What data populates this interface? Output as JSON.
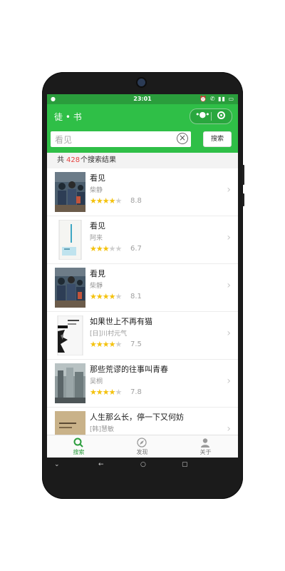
{
  "status_bar": {
    "time": "23:01",
    "left_icon": "notification-dot-icon",
    "right_icons": "⏰ ✆ ▮▮ ▭"
  },
  "nav": {
    "title": "徒 • 书",
    "more_icon": "more-dots-icon",
    "close_icon": "target-icon"
  },
  "search": {
    "value": "看见",
    "button_label": "搜索"
  },
  "results": {
    "prefix": "共",
    "count": "428",
    "suffix": "个搜索结果"
  },
  "books": [
    {
      "title": "看见",
      "author": "柴静",
      "rating": 4.4,
      "score": "8.8"
    },
    {
      "title": "看见",
      "author": "阿来",
      "rating": 3.35,
      "score": "6.7"
    },
    {
      "title": "看見",
      "author": "柴靜",
      "rating": 4.05,
      "score": "8.1"
    },
    {
      "title": "如果世上不再有猫",
      "author": "[日]川村元气",
      "rating": 3.75,
      "score": "7.5"
    },
    {
      "title": "那些荒谬的往事叫青春",
      "author": "吴桐",
      "rating": 3.9,
      "score": "7.8"
    },
    {
      "title": "人生那么长，停一下又何妨",
      "author": "[韩]慧敏",
      "rating": 0,
      "score": ""
    }
  ],
  "tabs": [
    {
      "label": "搜索",
      "icon": "search-icon",
      "active": true
    },
    {
      "label": "发现",
      "icon": "compass-icon",
      "active": false
    },
    {
      "label": "关于",
      "icon": "person-icon",
      "active": false
    }
  ],
  "colors": {
    "brand": "#2fbf47",
    "status_bar": "#2a9d3c",
    "count": "#e64340",
    "star": "#f4c20d"
  }
}
